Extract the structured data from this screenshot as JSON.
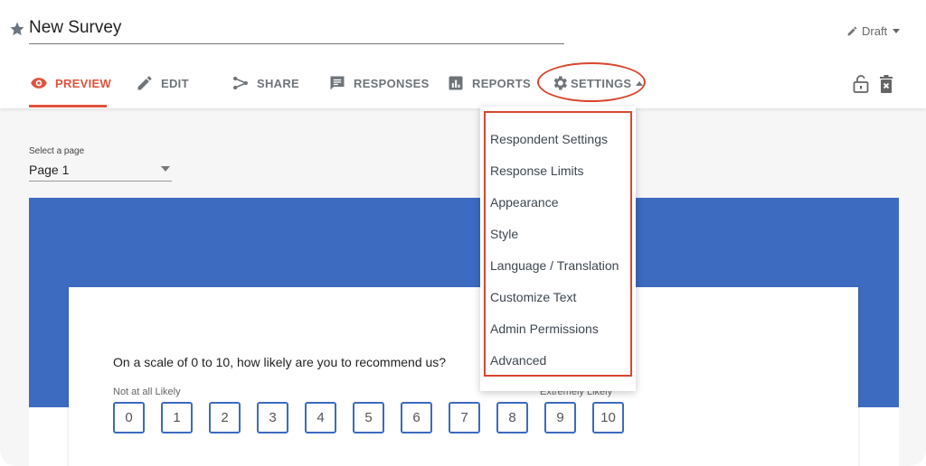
{
  "survey": {
    "title": "New Survey",
    "status": "Draft"
  },
  "tabs": [
    {
      "label": "PREVIEW",
      "icon": "eye-icon",
      "active": true
    },
    {
      "label": "EDIT",
      "icon": "pencil-icon"
    },
    {
      "label": "SHARE",
      "icon": "share-icon"
    },
    {
      "label": "RESPONSES",
      "icon": "responses-icon"
    },
    {
      "label": "REPORTS",
      "icon": "reports-icon"
    },
    {
      "label": "SETTINGS",
      "icon": "gear-icon",
      "expanded": true
    }
  ],
  "toolbar": {
    "lock_icon": "unlock-icon",
    "delete_icon": "trash-icon"
  },
  "page_select": {
    "label": "Select a page",
    "value": "Page 1"
  },
  "settings_menu": [
    "Respondent Settings",
    "Response Limits",
    "Appearance",
    "Style",
    "Language / Translation",
    "Customize Text",
    "Admin Permissions",
    "Advanced"
  ],
  "question": {
    "text": "On a scale of 0 to 10, how likely are you to recommend us?",
    "low_label": "Not at all Likely",
    "high_label": "Extremely Likely",
    "options": [
      "0",
      "1",
      "2",
      "3",
      "4",
      "5",
      "6",
      "7",
      "8",
      "9",
      "10"
    ]
  },
  "colors": {
    "accent": "#e0533d",
    "brand_blue": "#3c6bc0",
    "highlight": "#d9472f"
  }
}
